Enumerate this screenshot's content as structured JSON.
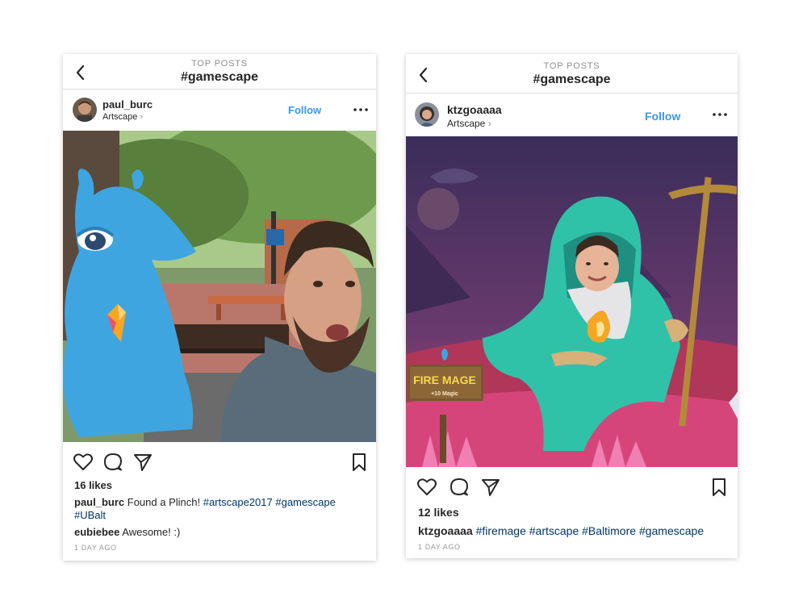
{
  "posts": [
    {
      "top_label": "TOP POSTS",
      "hashtag_title": "#gamescape",
      "username": "paul_burc",
      "location": "Artscape",
      "follow_label": "Follow",
      "likes": "16 likes",
      "caption_user": "paul_burc",
      "caption_text": "Found a Plinch!",
      "caption_tags": [
        "#artscape2017",
        "#gamescape",
        "#UBalt"
      ],
      "comment_user": "eubiebee",
      "comment_text": "Awesome! :)",
      "timestamp": "1 DAY AGO"
    },
    {
      "top_label": "TOP POSTS",
      "hashtag_title": "#gamescape",
      "username": "ktzgoaaaa",
      "location": "Artscape",
      "follow_label": "Follow",
      "likes": "12 likes",
      "caption_user": "ktzgoaaaa",
      "caption_tags": [
        "#firemage",
        "#artscape",
        "#Baltimore",
        "#gamescape"
      ],
      "sign_title": "FIRE MAGE",
      "sign_sub": "+10 Magic",
      "timestamp": "1 DAY AGO"
    }
  ],
  "icons": [
    "back-chevron-icon",
    "more-dots-icon",
    "heart-icon",
    "comment-icon",
    "share-icon",
    "bookmark-icon"
  ],
  "colors": {
    "link": "#3897f0",
    "hashtag": "#003569",
    "muted": "#8e8e8e"
  }
}
